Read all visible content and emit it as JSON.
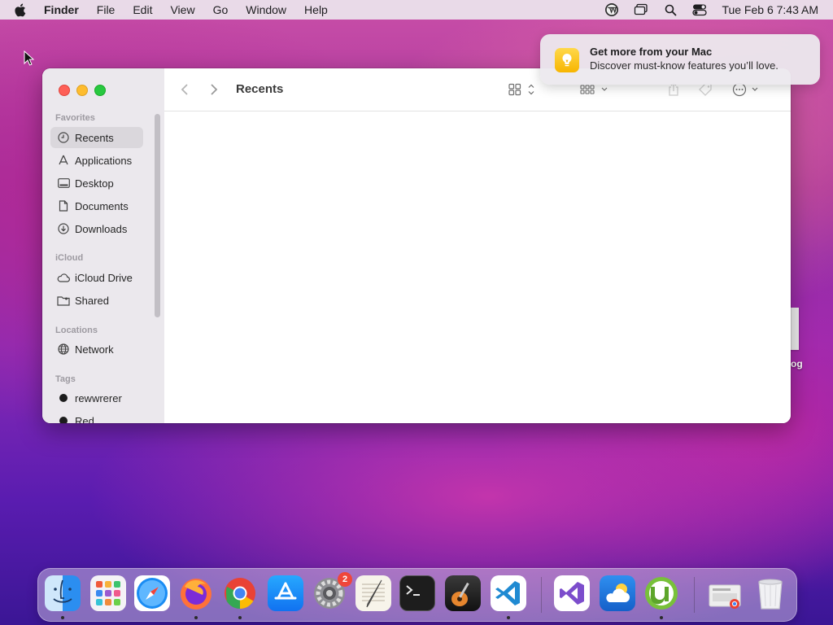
{
  "menubar": {
    "app_name": "Finder",
    "items": [
      "File",
      "Edit",
      "View",
      "Go",
      "Window",
      "Help"
    ],
    "clock": "Tue Feb 6  7:43 AM"
  },
  "notification": {
    "title": "Get more from your Mac",
    "body": "Discover must-know features you’ll love."
  },
  "finder": {
    "toolbar_title": "Recents",
    "sidebar": {
      "favorites_header": "Favorites",
      "favorites": [
        {
          "label": "Recents",
          "icon": "clock-icon",
          "active": true
        },
        {
          "label": "Applications",
          "icon": "applications-icon"
        },
        {
          "label": "Desktop",
          "icon": "desktop-icon"
        },
        {
          "label": "Documents",
          "icon": "document-icon"
        },
        {
          "label": "Downloads",
          "icon": "download-icon"
        }
      ],
      "icloud_header": "iCloud",
      "icloud": [
        {
          "label": "iCloud Drive",
          "icon": "cloud-icon"
        },
        {
          "label": "Shared",
          "icon": "shared-folder-icon"
        }
      ],
      "locations_header": "Locations",
      "locations": [
        {
          "label": "Network",
          "icon": "globe-icon"
        }
      ],
      "tags_header": "Tags",
      "tags": [
        {
          "label": "rewwrerer",
          "color": "#1c1c1c"
        },
        {
          "label": "Red",
          "color": "#1c1c1c"
        }
      ]
    }
  },
  "desktop": {
    "partial_file_label": "og"
  },
  "dock": {
    "apps": [
      {
        "name": "Finder",
        "icon": "finder-icon",
        "running": true
      },
      {
        "name": "Launchpad",
        "icon": "launchpad-icon",
        "running": false
      },
      {
        "name": "Safari",
        "icon": "safari-icon",
        "running": false
      },
      {
        "name": "Firefox",
        "icon": "firefox-icon",
        "running": true
      },
      {
        "name": "Chrome",
        "icon": "chrome-icon",
        "running": true
      },
      {
        "name": "App Store",
        "icon": "app-store-icon",
        "running": false
      },
      {
        "name": "System Preferences",
        "icon": "system-preferences-icon",
        "running": false,
        "badge": "2"
      },
      {
        "name": "TextEdit",
        "icon": "textedit-icon",
        "running": false
      },
      {
        "name": "Terminal",
        "icon": "terminal-icon",
        "running": false
      },
      {
        "name": "GarageBand",
        "icon": "garageband-icon",
        "running": false
      },
      {
        "name": "Visual Studio Code",
        "icon": "vscode-icon",
        "running": true
      },
      {
        "name": "Visual Studio",
        "icon": "visual-studio-icon",
        "running": false
      },
      {
        "name": "Weather",
        "icon": "weather-icon",
        "running": false
      },
      {
        "name": "uTorrent",
        "icon": "utorrent-icon",
        "running": true
      },
      {
        "name": "Downloads Stack",
        "icon": "downloads-stack-icon",
        "running": false
      },
      {
        "name": "Trash",
        "icon": "trash-icon",
        "running": false
      }
    ]
  }
}
